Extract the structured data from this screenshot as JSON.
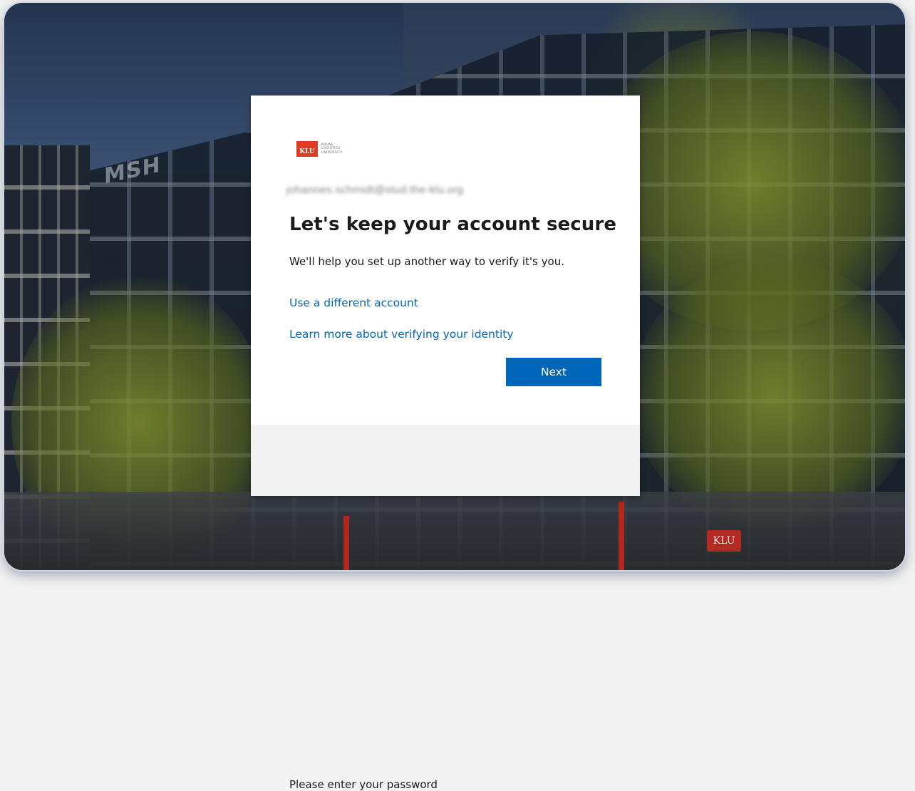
{
  "background": {
    "building_sign": "MSH",
    "storefront_sign": "KLU"
  },
  "logo": {
    "abbr": "KLU",
    "name_lines": [
      "KÜHNE",
      "LOGISTICS",
      "UNIVERSITY"
    ],
    "accent_color": "#e03a23"
  },
  "dialog": {
    "account_email": "johannes.schmidt@stud.the-klu.org",
    "title": "Let's keep your account secure",
    "subtitle": "We'll help you set up another way to verify it's you.",
    "link_different_account": "Use a different account",
    "link_learn_more": "Learn more about verifying your identity",
    "next_button": "Next",
    "footer_text": "Please enter your password"
  },
  "colors": {
    "primary": "#0067b8",
    "link": "#0067b8",
    "footer_bg": "#f2f2f2"
  }
}
